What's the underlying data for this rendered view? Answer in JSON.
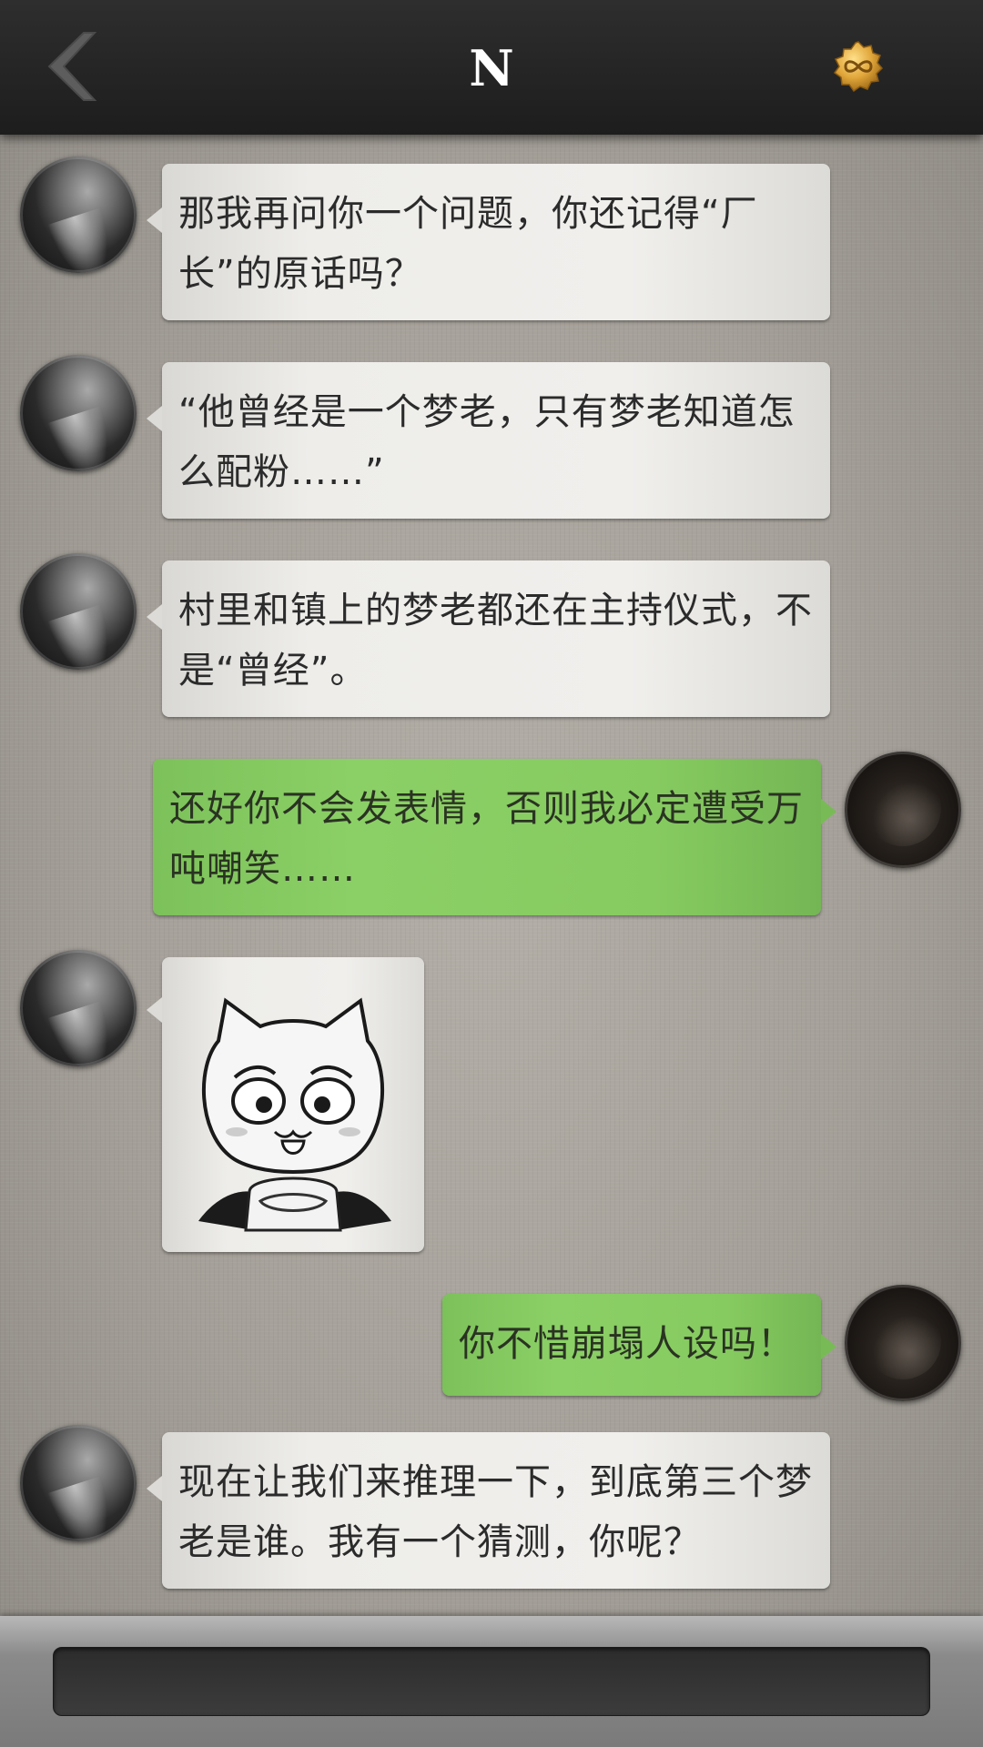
{
  "header": {
    "title": "N",
    "back_icon": "chevron-left-icon",
    "right_icon": "infinity-badge-icon",
    "badge_color": "#e0a63a"
  },
  "messages": [
    {
      "sender": "N",
      "side": "left",
      "type": "text",
      "text": "那我再问你一个问题，你还记得“厂长”的原话吗？"
    },
    {
      "sender": "N",
      "side": "left",
      "type": "text",
      "text": "“他曾经是一个梦老，只有梦老知道怎么配粉……”"
    },
    {
      "sender": "N",
      "side": "left",
      "type": "text",
      "text": "村里和镇上的梦老都还在主持仪式，不是“曾经”。"
    },
    {
      "sender": "me",
      "side": "right",
      "type": "text",
      "text": "还好你不会发表情，否则我必定遭受万吨嘲笑……"
    },
    {
      "sender": "N",
      "side": "left",
      "type": "sticker",
      "sticker": "cat-devil-sticker"
    },
    {
      "sender": "me",
      "side": "right",
      "type": "text",
      "text": "你不惜崩塌人设吗！"
    },
    {
      "sender": "N",
      "side": "left",
      "type": "text",
      "text": "现在让我们来推理一下，到底第三个梦老是谁。我有一个猜测，你呢？"
    }
  ],
  "input": {
    "value": "",
    "placeholder": ""
  },
  "colors": {
    "incoming_bubble": "#eeedea",
    "outgoing_bubble": "#86cb60",
    "header_bg": "#262626"
  }
}
